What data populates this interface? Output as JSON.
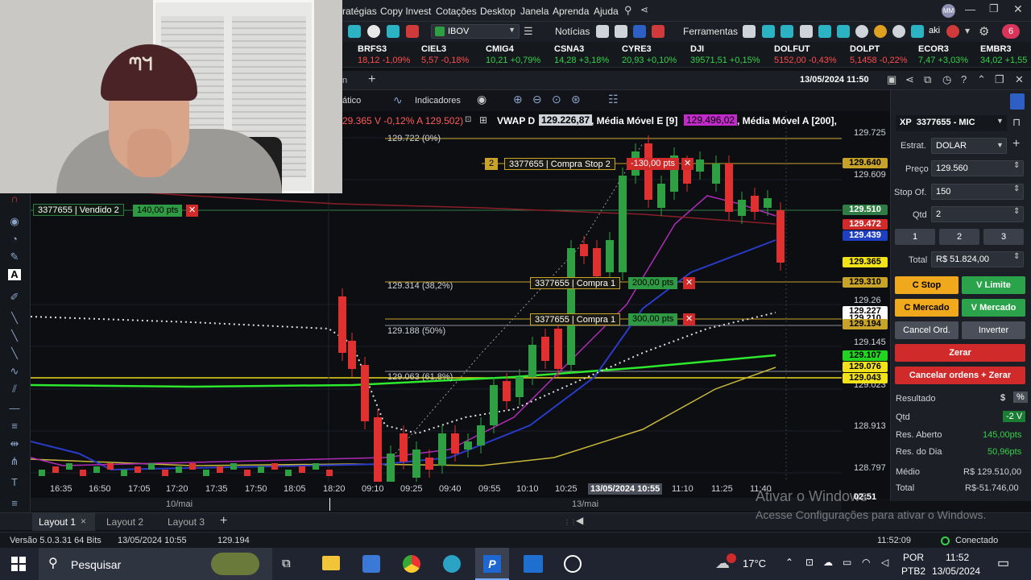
{
  "menu": [
    "ratégias",
    "Copy Invest",
    "Cotações",
    "Desktop",
    "Janela",
    "Aprenda",
    "Ajuda"
  ],
  "toolbar": {
    "ibov": "IBOV",
    "noticias": "Notícias",
    "ferramentas": "Ferramentas",
    "aki": "aki",
    "badge": "6",
    "avatar": "MM"
  },
  "ticker": [
    {
      "name": "BRFS3",
      "value": "18,12 -1,09%",
      "dir": "dn"
    },
    {
      "name": "CIEL3",
      "value": "5,57 -0,18%",
      "dir": "dn"
    },
    {
      "name": "CMIG4",
      "value": "10,21 +0,79%",
      "dir": "up"
    },
    {
      "name": "CSNA3",
      "value": "14,28 +3,18%",
      "dir": "up"
    },
    {
      "name": "CYRE3",
      "value": "20,93 +0,10%",
      "dir": "up"
    },
    {
      "name": "DJI",
      "value": "39571,51 +0,15%",
      "dir": "up"
    },
    {
      "name": "DOLFUT",
      "value": "5152,00 -0,43%",
      "dir": "dn"
    },
    {
      "name": "DOLPT",
      "value": "5,1458 -0,22%",
      "dir": "dn"
    },
    {
      "name": "ECOR3",
      "value": "7,47 +3,03%",
      "dir": "up"
    },
    {
      "name": "EMBR3",
      "value": "34,02 +1,55",
      "dir": "up"
    }
  ],
  "header": {
    "tab": "n",
    "datetime": "13/05/2024 11:50"
  },
  "chart_tools": {
    "left_label": "ático",
    "indicadores": "Indicadores"
  },
  "legend": {
    "quote": "29.365 V -0,12% A 129.502)",
    "vwap_label": "VWAP D",
    "vwap_value": "129.226,87",
    "mme_label": ", Média Móvel E [9]",
    "mme_value": "129.496,02",
    "mma_label": ", Média Móvel A [200],"
  },
  "orders": {
    "vendido": {
      "label": "3377655 | Vendido 2",
      "pts": "140,00 pts"
    },
    "compra_stop": {
      "qty": "2",
      "label": "3377655 | Compra Stop 2",
      "pts": "-130,00 pts"
    },
    "compra1a": {
      "label": "3377655 | Compra 1",
      "pts": "200,00 pts"
    },
    "compra1b": {
      "label": "3377655 | Compra 1",
      "pts": "300,00 pts"
    }
  },
  "fib": [
    {
      "label": "129.722 (0%)"
    },
    {
      "label": "129.314 (38,2%)"
    },
    {
      "label": "129.188 (50%)"
    },
    {
      "label": "129.063 (61,8%)"
    }
  ],
  "price_axis": [
    "129.725",
    "129.609",
    "129.26",
    "129.145",
    "129.023",
    "128.913",
    "128.797"
  ],
  "price_labels": [
    {
      "text": "129.640",
      "bg": "#c8a32a",
      "fg": "#000000"
    },
    {
      "text": "129.510",
      "bg": "#2f7d45",
      "fg": "#ffffff"
    },
    {
      "text": "129.472",
      "bg": "#d02a2a",
      "fg": "#ffffff"
    },
    {
      "text": "129.439",
      "bg": "#1e3fbf",
      "fg": "#ffffff"
    },
    {
      "text": "129.365",
      "bg": "#f2e21a",
      "fg": "#000000"
    },
    {
      "text": "129.310",
      "bg": "#c8a32a",
      "fg": "#000000"
    },
    {
      "text": "129.227",
      "bg": "#ffffff",
      "fg": "#000000"
    },
    {
      "text": "129.210",
      "bg": "#ffffff",
      "fg": "#000000"
    },
    {
      "text": "129.194",
      "bg": "#c8a32a",
      "fg": "#000000"
    },
    {
      "text": "129.107",
      "bg": "#22d422",
      "fg": "#000000"
    },
    {
      "text": "129.076",
      "bg": "#f2e21a",
      "fg": "#000000"
    },
    {
      "text": "129.043",
      "bg": "#f2e21a",
      "fg": "#000000"
    }
  ],
  "time_axis": [
    "16:35",
    "16:50",
    "17:05",
    "17:20",
    "17:35",
    "17:50",
    "18:05",
    "18:20",
    "09:10",
    "09:25",
    "09:40",
    "09:55",
    "10:10",
    "10:25",
    "11:10",
    "11:25",
    "11:40"
  ],
  "cursor_time": "13/05/2024 10:55",
  "date_axis": [
    "10/mai",
    "13/mai"
  ],
  "countdown": "02:51",
  "order_panel": {
    "broker": "XP",
    "account": "3377655 - MIC",
    "estrat_label": "Estrat.",
    "estrat": "DOLAR",
    "preco_label": "Preço",
    "preco": "129.560",
    "stop_label": "Stop Of.",
    "stop": "150",
    "qtd_label": "Qtd",
    "qtd": "2",
    "quick": [
      "1",
      "2",
      "3"
    ],
    "total_label": "Total",
    "total": "R$ 51.824,00",
    "c_stop": "C Stop",
    "v_limite": "V Limite",
    "c_mercado": "C Mercado",
    "v_mercado": "V Mercado",
    "cancel": "Cancel Ord.",
    "inverter": "Inverter",
    "zerar": "Zerar",
    "cancelar_zerar": "Cancelar ordens + Zerar",
    "resultado": "Resultado",
    "currency": "$",
    "pct": "%",
    "r_qtd_label": "Qtd",
    "r_qtd": "-2 V",
    "aberto_label": "Res. Aberto",
    "aberto": "145,00pts",
    "dia_label": "Res. do Dia",
    "dia": "50,96pts",
    "medio_label": "Médio",
    "medio": "R$ 129.510,00",
    "total2_label": "Total",
    "total2": "R$-51.746,00"
  },
  "tabs": [
    "Layout 1",
    "Layout 2",
    "Layout 3"
  ],
  "status": {
    "version": "Versão 5.0.3.31 64 Bits",
    "date": "13/05/2024 10:55",
    "price": "129.194",
    "time": "11:52:09",
    "conn": "Conectado"
  },
  "watermark": {
    "title": "Ativar o Windows",
    "sub": "Acesse Configurações para ativar o Windows."
  },
  "taskbar": {
    "search": "Pesquisar",
    "temp": "17°C",
    "lang1": "POR",
    "lang2": "PTB2",
    "clock": "11:52",
    "date": "13/05/2024"
  }
}
